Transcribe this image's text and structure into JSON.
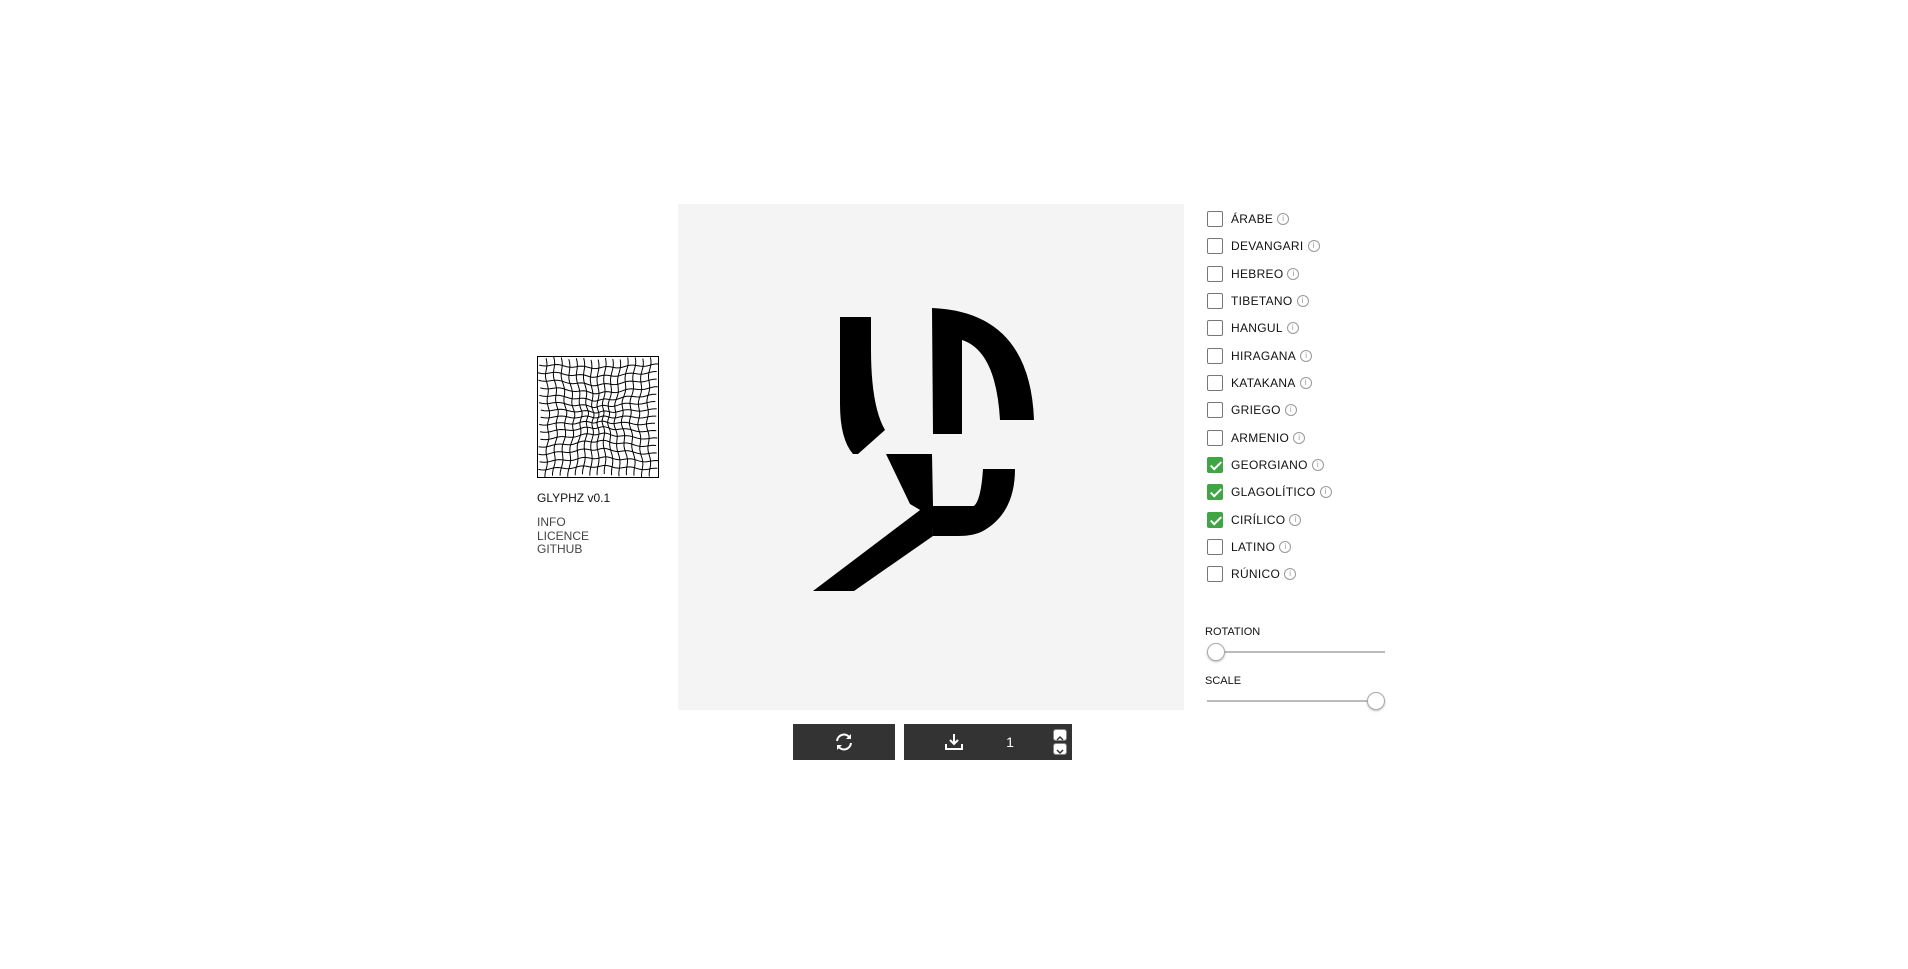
{
  "app": {
    "name": "GLYPHZ v0.1",
    "links": [
      "INFO",
      "LICENCE",
      "GITHUB"
    ]
  },
  "actions": {
    "refresh_icon": "refresh-icon",
    "download_icon": "download-icon",
    "download_count": "1"
  },
  "scripts": [
    {
      "label": "ÁRABE",
      "checked": false
    },
    {
      "label": "DEVANGARI",
      "checked": false
    },
    {
      "label": "HEBREO",
      "checked": false
    },
    {
      "label": "TIBETANO",
      "checked": false
    },
    {
      "label": "HANGUL",
      "checked": false
    },
    {
      "label": "HIRAGANA",
      "checked": false
    },
    {
      "label": "KATAKANA",
      "checked": false
    },
    {
      "label": "GRIEGO",
      "checked": false
    },
    {
      "label": "ARMENIO",
      "checked": false
    },
    {
      "label": "GEORGIANO",
      "checked": true
    },
    {
      "label": "GLAGOLÍTICO",
      "checked": true
    },
    {
      "label": "CIRÍLICO",
      "checked": true
    },
    {
      "label": "LATINO",
      "checked": false
    },
    {
      "label": "RÚNICO",
      "checked": false
    }
  ],
  "info_icon_glyph": "i",
  "sliders": {
    "rotation": {
      "label": "ROTATION",
      "value": 0
    },
    "scale": {
      "label": "SCALE",
      "value": 1
    }
  },
  "colors": {
    "checked": "#3fa545",
    "button": "#333333",
    "canvas": "#f4f4f4"
  }
}
